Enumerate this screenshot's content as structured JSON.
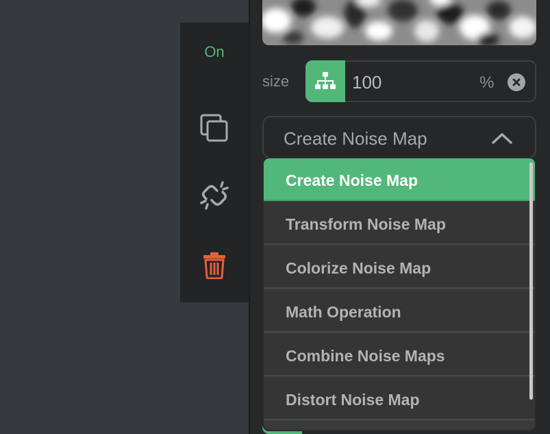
{
  "colors": {
    "accent": "#52b87a",
    "delete": "#e8603c",
    "panel_bg": "#262728",
    "canvas_bg": "#343a3d"
  },
  "toolbar": {
    "on_label": "On",
    "duplicate_icon": "duplicate-icon",
    "unlink_icon": "unlink-icon",
    "delete_icon": "trash-icon"
  },
  "size": {
    "label": "size",
    "value": "100",
    "unit": "%",
    "icon": "hierarchy-icon",
    "clear_icon": "clear-icon"
  },
  "node_type": {
    "selected": "Create Noise Map",
    "chevron_icon": "chevron-up-icon"
  },
  "dropdown": {
    "items": [
      {
        "label": "Create Noise Map"
      },
      {
        "label": "Transform Noise Map"
      },
      {
        "label": "Colorize Noise Map"
      },
      {
        "label": "Math Operation"
      },
      {
        "label": "Combine Noise Maps"
      },
      {
        "label": "Distort Noise Map"
      }
    ]
  }
}
